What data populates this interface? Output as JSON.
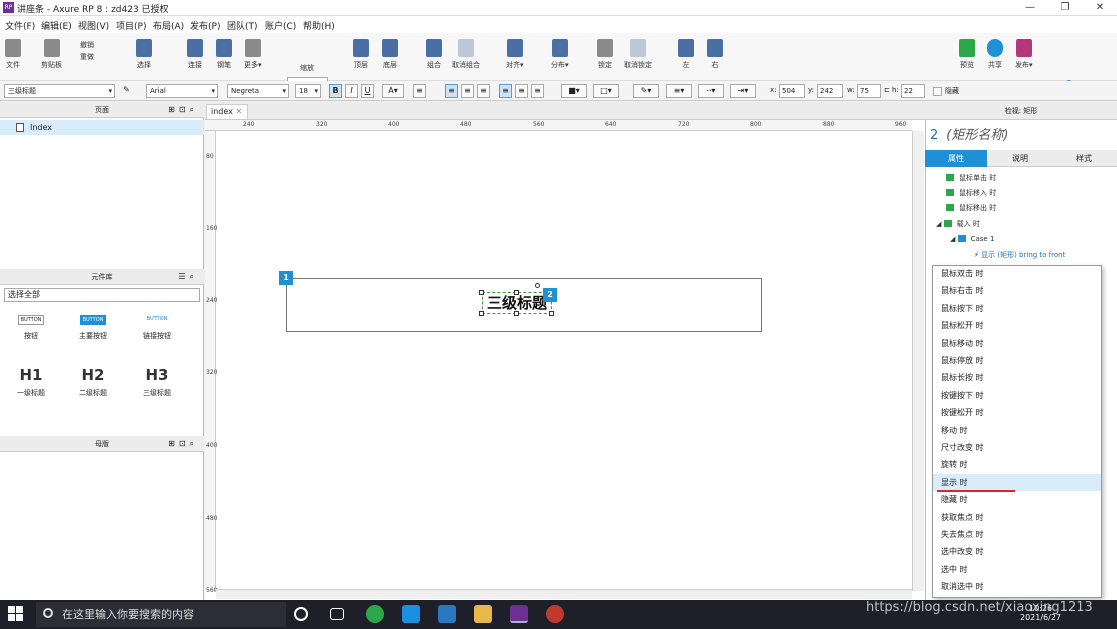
{
  "app": {
    "title": "讲座条 - Axure RP 8 : zd423 已授权",
    "logo": "RP"
  },
  "menu": [
    "文件(F)",
    "编辑(E)",
    "视图(V)",
    "项目(P)",
    "布局(A)",
    "发布(P)",
    "团队(T)",
    "账户(C)",
    "帮助(H)"
  ],
  "toolbar": {
    "items": [
      "文件",
      "剪贴板",
      "选择",
      "连接",
      "钢笔",
      "更多▾",
      "缩放",
      "顶层",
      "底层",
      "组合",
      "取消组合",
      "对齐▾",
      "分布▾",
      "锁定",
      "取消锁定",
      "左",
      "右",
      "预览",
      "共享",
      "发布▾"
    ],
    "undo": "撤销",
    "redo": "重做",
    "zoom": "125%",
    "login": "登录"
  },
  "format": {
    "style": "三级标题",
    "font": "Arial",
    "weight": "Negreta",
    "size": "18",
    "x_label": "x:",
    "x": "504",
    "y_label": "y:",
    "y": "242",
    "w_label": "w:",
    "w": "75",
    "h_label": "h:",
    "h": "22",
    "hide_label": "隐藏"
  },
  "left": {
    "pages_title": "页面",
    "page_item": "Index",
    "library_title": "元件库",
    "library_filter": "选择全部",
    "widgets": [
      {
        "icon": "BUTTON",
        "label": "按钮"
      },
      {
        "icon": "BUTTON",
        "label": "主要按钮"
      },
      {
        "icon": "BUTTON",
        "label": "链接按钮"
      },
      {
        "icon": "H1",
        "label": "一级标题"
      },
      {
        "icon": "H2",
        "label": "二级标题"
      },
      {
        "icon": "H3",
        "label": "三级标题"
      }
    ],
    "masters_title": "母版"
  },
  "canvas": {
    "tab": "index",
    "h_ticks": [
      "240",
      "320",
      "400",
      "480",
      "560",
      "640",
      "720",
      "800",
      "880",
      "960"
    ],
    "v_ticks": [
      "80",
      "160",
      "240",
      "320",
      "400",
      "480",
      "560"
    ],
    "badge1": "1",
    "badge2": "2",
    "heading_text": "三级标题"
  },
  "right": {
    "header": "检视: 矩形",
    "widget_num": "2",
    "widget_name": "(矩形名称)",
    "tabs": [
      "属性",
      "说明",
      "样式"
    ],
    "events": [
      "鼠标单击 时",
      "鼠标移入 时",
      "鼠标移出 时",
      "载入 时",
      "Case 1"
    ],
    "action": "显示 (矩形) bring to front",
    "dropdown": [
      "鼠标双击 时",
      "鼠标右击 时",
      "鼠标按下 时",
      "鼠标松开 时",
      "鼠标移动 时",
      "鼠标停放 时",
      "鼠标长按 时",
      "按键按下 时",
      "按键松开 时",
      "移动 时",
      "尺寸改变 时",
      "旋转 时",
      "显示 时",
      "隐藏 时",
      "获取焦点 时",
      "失去焦点 时",
      "选中改变 时",
      "选中 时",
      "取消选中 时"
    ],
    "highlight_index": 12
  },
  "taskbar": {
    "search_placeholder": "在这里输入你要搜索的内容",
    "watermark": "https://blog.csdn.net/xiaoxing1213",
    "date": "2021/6/27",
    "time": "10:26"
  },
  "colors": {
    "accent": "#1e90d6",
    "underline": "#e0222a"
  }
}
